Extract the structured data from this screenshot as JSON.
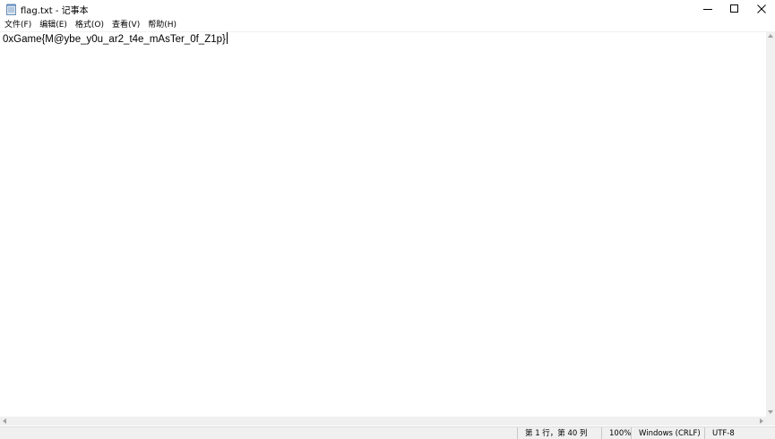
{
  "window": {
    "title": "flag.txt - 记事本",
    "controls": {
      "minimize": "minimize-icon",
      "maximize": "maximize-icon",
      "close": "close-icon"
    }
  },
  "menu": {
    "items": [
      {
        "label": "文件(F)"
      },
      {
        "label": "编辑(E)"
      },
      {
        "label": "格式(O)"
      },
      {
        "label": "查看(V)"
      },
      {
        "label": "帮助(H)"
      }
    ]
  },
  "editor": {
    "content": "0xGame{M@ybe_y0u_ar2_t4e_mAsTer_0f_Z1p}"
  },
  "statusbar": {
    "position": "第 1 行，第 40 列",
    "zoom": "100%",
    "line_ending": "Windows (CRLF)",
    "encoding": "UTF-8"
  }
}
